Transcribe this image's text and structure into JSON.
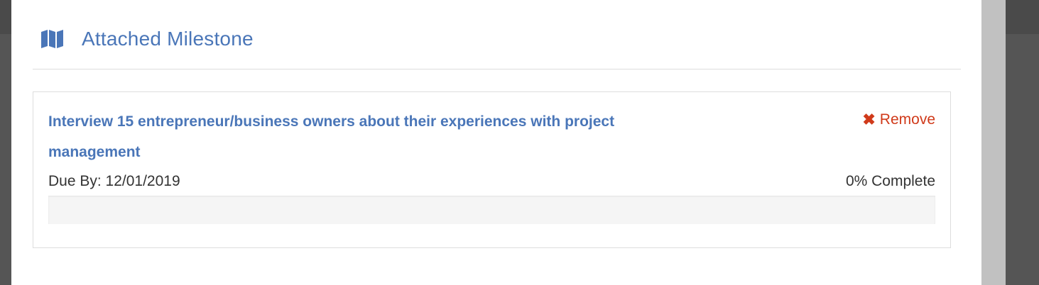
{
  "section": {
    "title": "Attached Milestone",
    "icon": "map-icon"
  },
  "milestone": {
    "title": "Interview 15 entrepreneur/business owners about their experiences with project management",
    "remove_label": "Remove",
    "remove_icon": "close-icon",
    "due_text": "Due By: 12/01/2019",
    "complete_text": "0% Complete",
    "progress_fraction": 0
  },
  "colors": {
    "accent": "#4a76b8",
    "danger": "#d03a1a",
    "text": "#333333"
  }
}
